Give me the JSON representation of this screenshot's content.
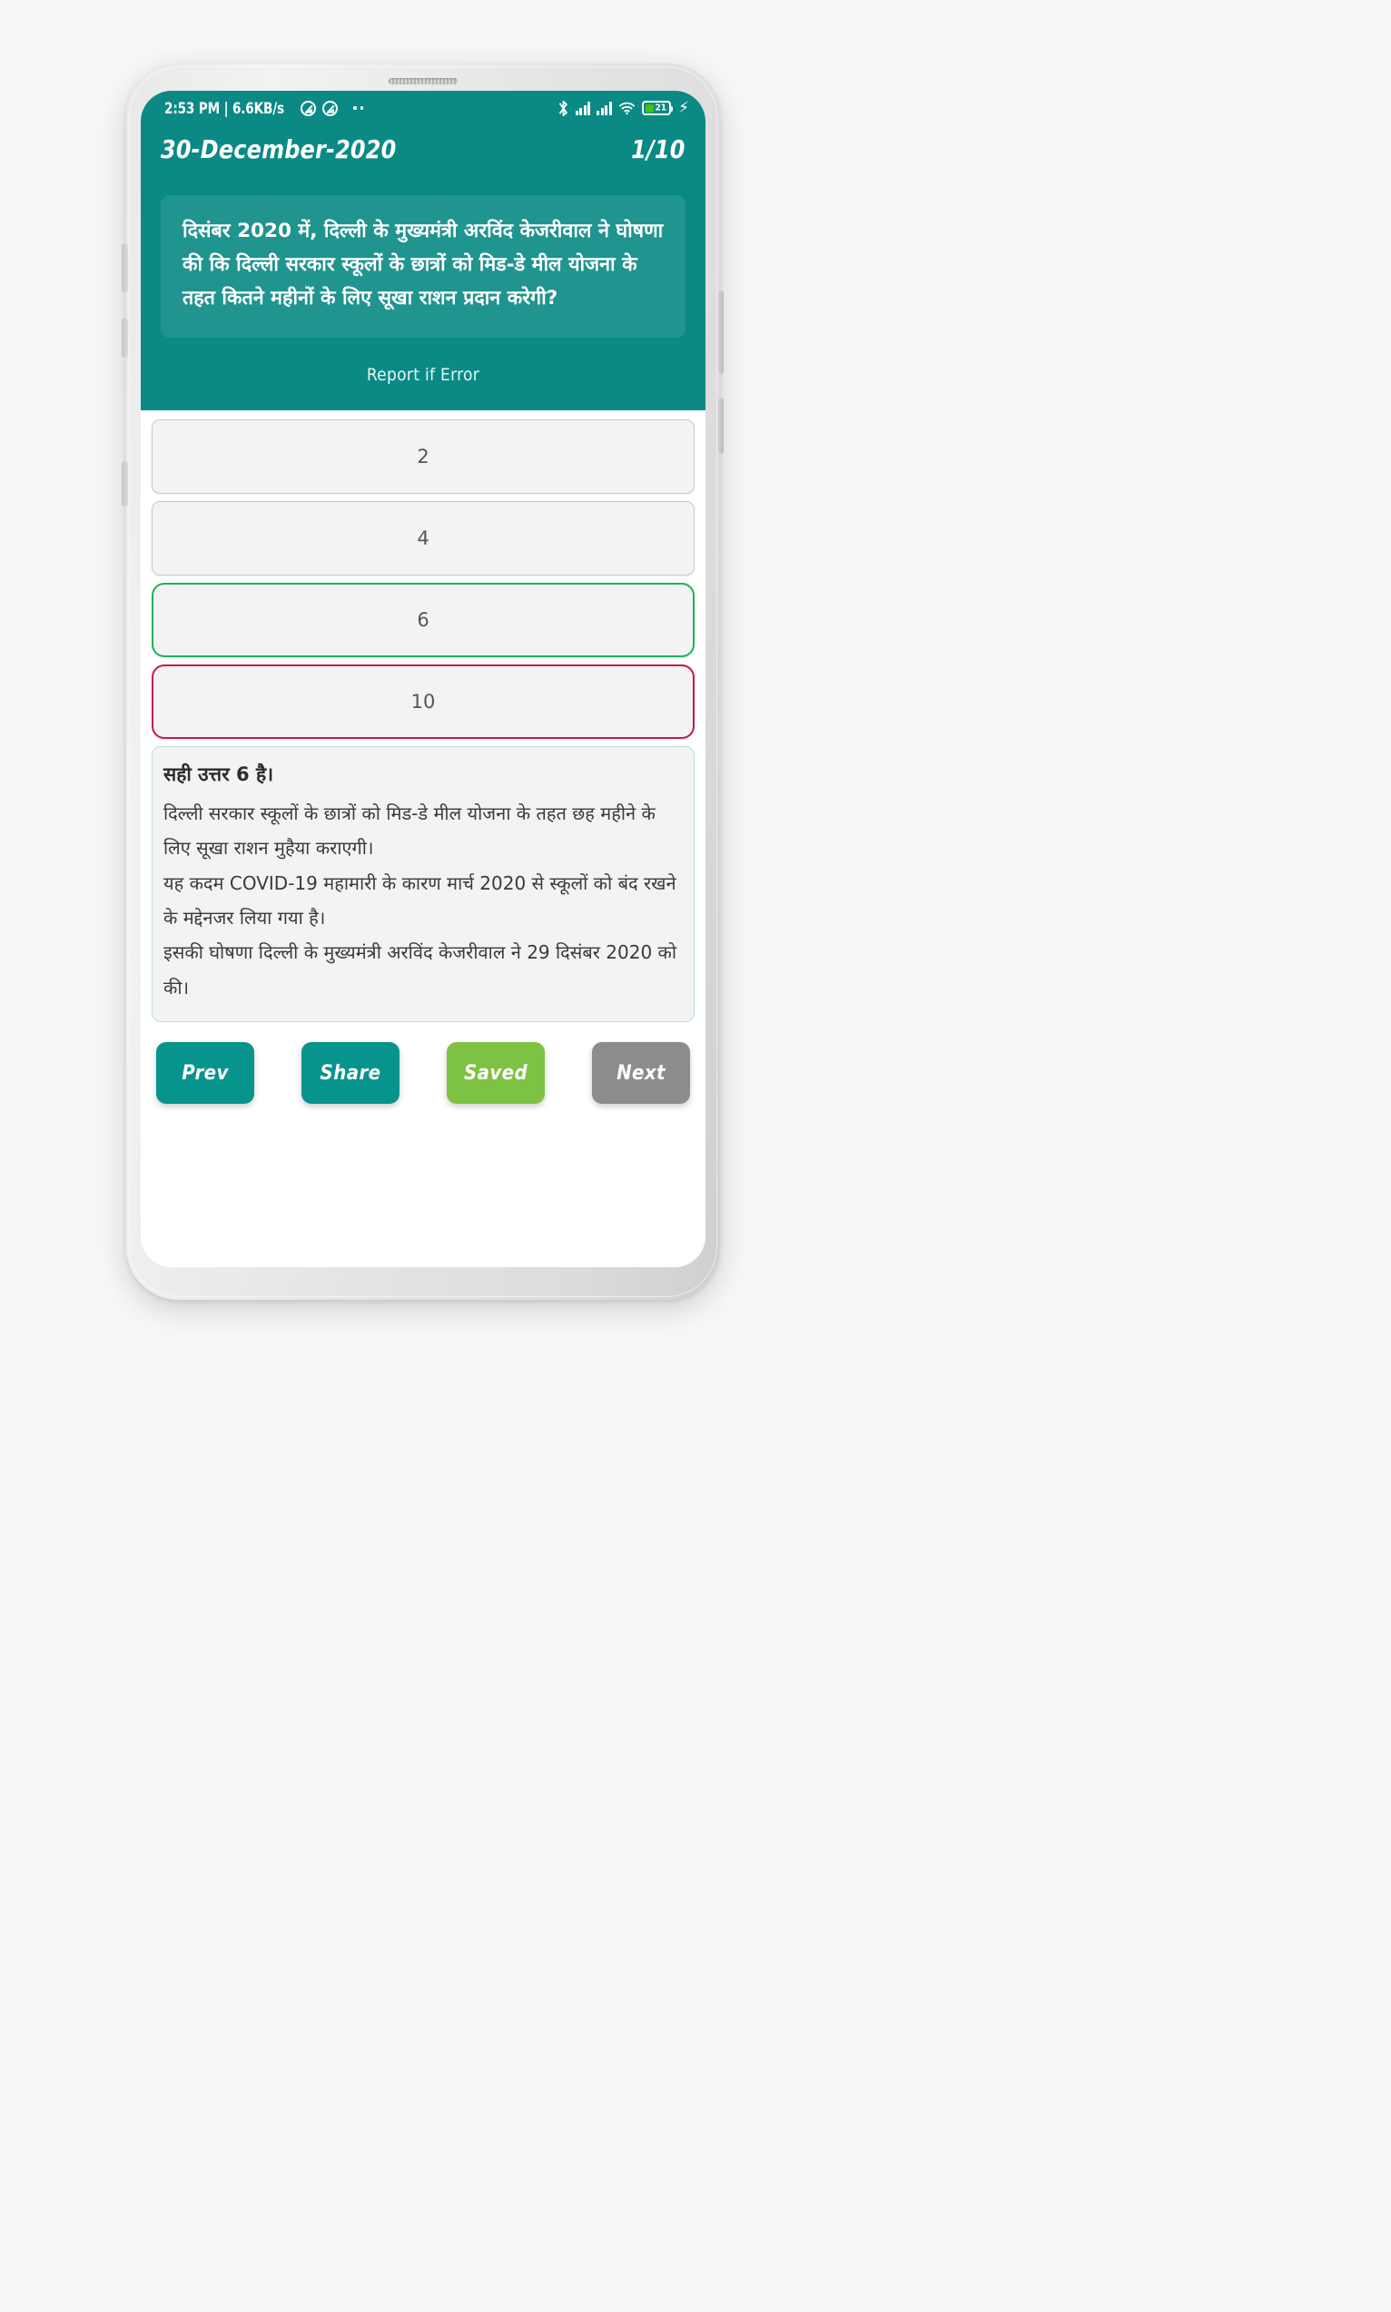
{
  "statusbar": {
    "clock": "2:53 PM | 6.6KB/s",
    "icons_left": [
      "no-signal-icon",
      "no-signal-icon",
      "more-dots-icon"
    ],
    "icons_right": [
      "bluetooth-icon",
      "signal-bars-icon",
      "signal-bars-icon",
      "wifi-icon",
      "battery-icon",
      "charging-bolt-icon"
    ],
    "battery_percent": "21",
    "battery_fill_color": "#3fc115"
  },
  "header": {
    "date": "30-December-2020",
    "counter": "1/10",
    "background_color": "#0b8a85"
  },
  "question": {
    "text": "दिसंबर 2020 में, दिल्ली के मुख्यमंत्री अरविंद केजरीवाल ने घोषणा की कि दिल्ली सरकार स्कूलों के छात्रों को मिड-डे मील योजना के तहत कितने महीनों के लिए सूखा राशन प्रदान करेगी?",
    "report_label": "Report if Error"
  },
  "options": [
    {
      "label": "2",
      "state": "neutral"
    },
    {
      "label": "4",
      "state": "neutral"
    },
    {
      "label": "6",
      "state": "correct"
    },
    {
      "label": "10",
      "state": "wrong"
    }
  ],
  "option_colors": {
    "correct_border": "#16b657",
    "wrong_border": "#c7184c",
    "neutral_border": "#c9c9c9",
    "fill": "#f3f3f3"
  },
  "explanation": {
    "title": "सही उत्तर 6 है।",
    "paragraphs": [
      "दिल्ली सरकार स्कूलों के छात्रों को मिड-डे मील योजना के तहत छह महीने के लिए सूखा राशन मुहैया कराएगी।",
      "यह कदम COVID-19 महामारी के कारण मार्च 2020 से स्कूलों को बंद रखने के मद्देनजर लिया गया है।",
      "इसकी घोषणा दिल्ली के मुख्यमंत्री अरविंद केजरीवाल ने 29 दिसंबर 2020 को की।"
    ]
  },
  "footer": {
    "buttons": [
      {
        "label": "Prev",
        "color": "#07948c",
        "style": "teal"
      },
      {
        "label": "Share",
        "color": "#07948c",
        "style": "teal"
      },
      {
        "label": "Saved",
        "color": "#7dc242",
        "style": "green"
      },
      {
        "label": "Next",
        "color": "#8c8c8c",
        "style": "gray"
      }
    ]
  }
}
